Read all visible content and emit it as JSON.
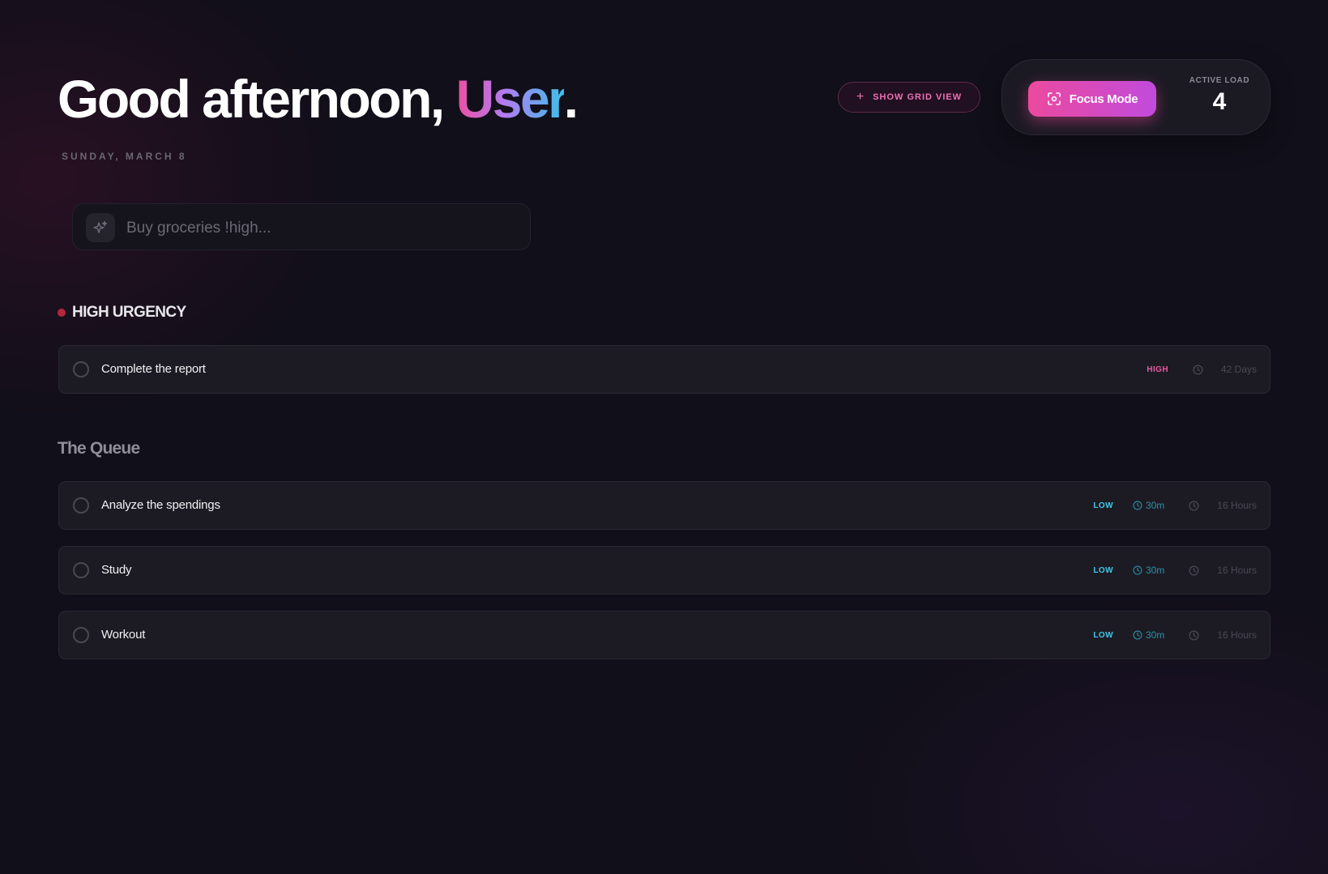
{
  "header": {
    "greeting_prefix": "Good afternoon, ",
    "user_name": "User",
    "greeting_suffix": ".",
    "date": "SUNDAY, MARCH 8"
  },
  "toolbar": {
    "grid_view_label": "SHOW GRID VIEW",
    "grid_view_icon": "plus-icon",
    "focus_mode_label": "Focus Mode",
    "focus_mode_icon": "focus-target-icon",
    "active_load_label": "ACTIVE LOAD",
    "active_load_value": "4"
  },
  "quick_add": {
    "placeholder": "Buy groceries !high...",
    "icon": "sparkle-icon"
  },
  "sections": {
    "high_urgency": {
      "title": "HIGH URGENCY",
      "tasks": [
        {
          "name": "Complete the report",
          "priority": "HIGH",
          "due": "42 Days"
        }
      ]
    },
    "queue": {
      "title": "The Queue",
      "tasks": [
        {
          "name": "Analyze the spendings",
          "priority": "LOW",
          "estimate": "30m",
          "due": "16 Hours"
        },
        {
          "name": "Study",
          "priority": "LOW",
          "estimate": "30m",
          "due": "16 Hours"
        },
        {
          "name": "Workout",
          "priority": "LOW",
          "estimate": "30m",
          "due": "16 Hours"
        }
      ]
    }
  },
  "colors": {
    "background": "#110f19",
    "accent_pink": "#ec4a9e",
    "accent_purple": "#c14bdc",
    "accent_cyan": "#3ec9ec",
    "urgent_dot": "#b3283d"
  }
}
